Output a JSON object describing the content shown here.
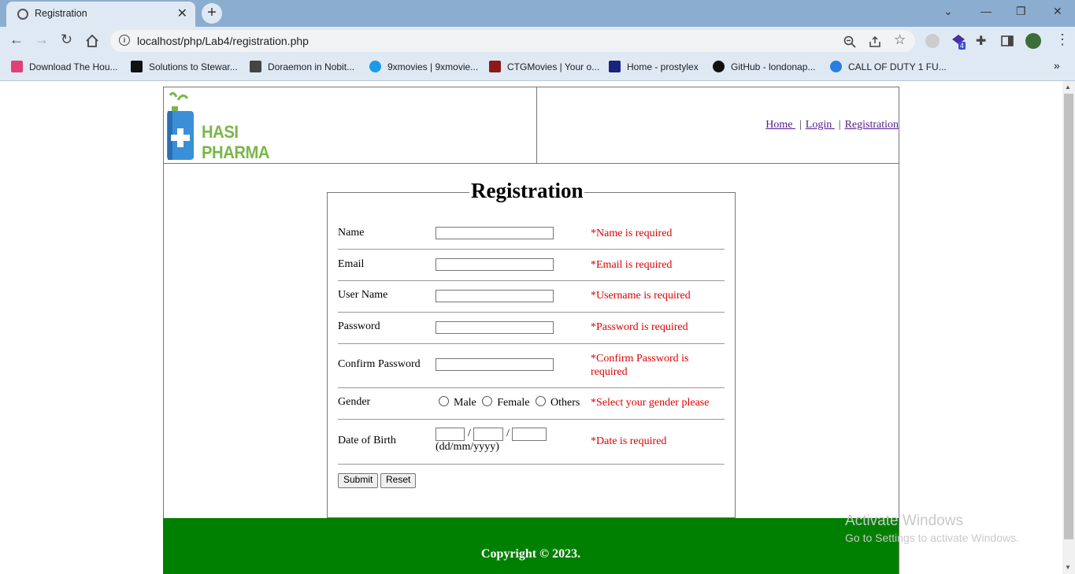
{
  "browser": {
    "tab_title": "Registration",
    "url": "localhost/php/Lab4/registration.php",
    "extension_badge": "4",
    "bookmarks": [
      {
        "label": "Download The Hou...",
        "color": "#e0407a"
      },
      {
        "label": "Solutions to Stewar...",
        "color": "#111111"
      },
      {
        "label": "Doraemon in Nobit...",
        "color": "#444444"
      },
      {
        "label": "9xmovies | 9xmovie...",
        "color": "#1a9be8"
      },
      {
        "label": "CTGMovies | Your o...",
        "color": "#8b1a1a"
      },
      {
        "label": "Home - prostylex",
        "color": "#1a237e"
      },
      {
        "label": "GitHub - londonap...",
        "color": "#111111"
      },
      {
        "label": "CALL OF DUTY 1 FU...",
        "color": "#2a7de1"
      }
    ]
  },
  "header": {
    "logo_text": "HASI PHARMA",
    "nav": [
      {
        "label": "Home "
      },
      {
        "label": "Login "
      },
      {
        "label": "Registration"
      }
    ],
    "separator": "|"
  },
  "form": {
    "legend": "Registration",
    "fields": {
      "name": {
        "label": "Name",
        "error": "*Name is required"
      },
      "email": {
        "label": "Email",
        "error": "*Email is required"
      },
      "username": {
        "label": "User Name",
        "error": "*Username is required"
      },
      "password": {
        "label": "Password",
        "error": "*Password is required"
      },
      "confirm": {
        "label": "Confirm Password",
        "error": "*Confirm Password is required"
      },
      "gender": {
        "label": "Gender",
        "options": [
          "Male",
          "Female",
          "Others"
        ],
        "error": "*Select your gender please"
      },
      "dob": {
        "label": "Date of Birth",
        "slash": "/",
        "hint": "(dd/mm/yyyy)",
        "error": "*Date is required"
      }
    },
    "submit_label": "Submit",
    "reset_label": "Reset"
  },
  "footer": {
    "copyright": "Copyright © 2023."
  },
  "watermark": {
    "line1": "Activate Windows",
    "line2": "Go to Settings to activate Windows."
  },
  "colors": {
    "error": "#dd0000",
    "footer_bg": "#008000",
    "logo_green": "#7ab648",
    "logo_blue": "#3a8fd8"
  }
}
